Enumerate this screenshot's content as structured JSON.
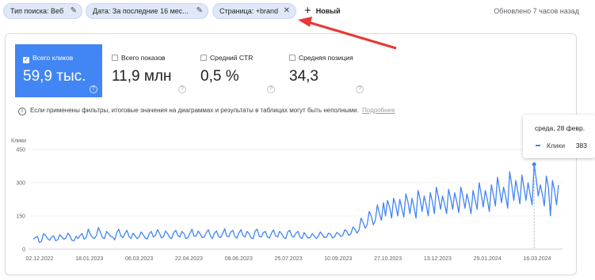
{
  "filters": {
    "search_type": "Тип поиска: Веб",
    "date": "Дата: За последние 16 мес...",
    "page": "Страница: +brand",
    "new_label": "Новый",
    "updated": "Обновлено 7 часов назад"
  },
  "metrics": [
    {
      "label": "Всего кликов",
      "value": "59,9 тыс.",
      "active": true
    },
    {
      "label": "Всего показов",
      "value": "11,9 млн",
      "active": false
    },
    {
      "label": "Средний CTR",
      "value": "0,5 %",
      "active": false
    },
    {
      "label": "Средняя позиция",
      "value": "34,3",
      "active": false
    }
  ],
  "notice": {
    "text": "Если применены фильтры, итоговые значения на диаграммах и результаты в таблицах могут быть неполными.",
    "link": "Подробнее"
  },
  "tooltip": {
    "date": "среда, 28 февр.",
    "series": "Клики",
    "value": "383"
  },
  "colors": {
    "accent": "#4285f4",
    "arrow": "#e53935"
  },
  "chart_data": {
    "type": "line",
    "ylabel": "Клики",
    "ylim": [
      0,
      450
    ],
    "yticks": [
      "0",
      "150",
      "300",
      "450"
    ],
    "xticks": [
      "02.12.2022",
      "18.01.2023",
      "06.03.2023",
      "22.04.2023",
      "08.06.2023",
      "25.07.2023",
      "10.09.2023",
      "27.10.2023",
      "13.12.2023",
      "29.01.2024",
      "16.03.2024"
    ],
    "series": [
      {
        "name": "Клики",
        "values": [
          45,
          52,
          58,
          30,
          35,
          70,
          62,
          48,
          40,
          55,
          60,
          38,
          42,
          65,
          55,
          45,
          50,
          72,
          60,
          40,
          38,
          58,
          48,
          62,
          70,
          45,
          52,
          90,
          68,
          55,
          48,
          62,
          98,
          75,
          52,
          48,
          80,
          70,
          58,
          55,
          42,
          75,
          90,
          60,
          52,
          70,
          85,
          58,
          48,
          72,
          60,
          48,
          55,
          78,
          65,
          50,
          46,
          70,
          80,
          55,
          62,
          88,
          72,
          50,
          58,
          82,
          70,
          52,
          48,
          75,
          85,
          62,
          55,
          80,
          70,
          48,
          52,
          72,
          90,
          58,
          60,
          82,
          68,
          52,
          55,
          75,
          88,
          60,
          48,
          72,
          82,
          58,
          52,
          70,
          92,
          60,
          55,
          78,
          85,
          58,
          50,
          72,
          88,
          62,
          55,
          80,
          70,
          50,
          48,
          82,
          90,
          58,
          55,
          75,
          80,
          55,
          50,
          72,
          88,
          60,
          55,
          80,
          70,
          52,
          48,
          78,
          85,
          58,
          55,
          72,
          80,
          55,
          48,
          75,
          62,
          50,
          52,
          70,
          60,
          48,
          58,
          78,
          65,
          52,
          55,
          72,
          68,
          50,
          56,
          75,
          70,
          58,
          62,
          88,
          80,
          62,
          70,
          100,
          90,
          72,
          88,
          140,
          120,
          95,
          110,
          170,
          150,
          110,
          130,
          200,
          160,
          130,
          210,
          150,
          220,
          190,
          140,
          230,
          200,
          150,
          225,
          185,
          145,
          250,
          215,
          160,
          230,
          190,
          140,
          265,
          225,
          170,
          240,
          200,
          150,
          255,
          215,
          160,
          280,
          235,
          180,
          240,
          205,
          160,
          270,
          230,
          180,
          255,
          215,
          165,
          280,
          240,
          185,
          250,
          210,
          160,
          265,
          225,
          180,
          300,
          250,
          190,
          265,
          225,
          170,
          290,
          245,
          195,
          325,
          270,
          210,
          280,
          240,
          185,
          350,
          290,
          220,
          310,
          260,
          205,
          335,
          280,
          220,
          300,
          250,
          200,
          383,
          320,
          240,
          290,
          250,
          195,
          330,
          280,
          150,
          310,
          265,
          200,
          290
        ]
      }
    ]
  }
}
